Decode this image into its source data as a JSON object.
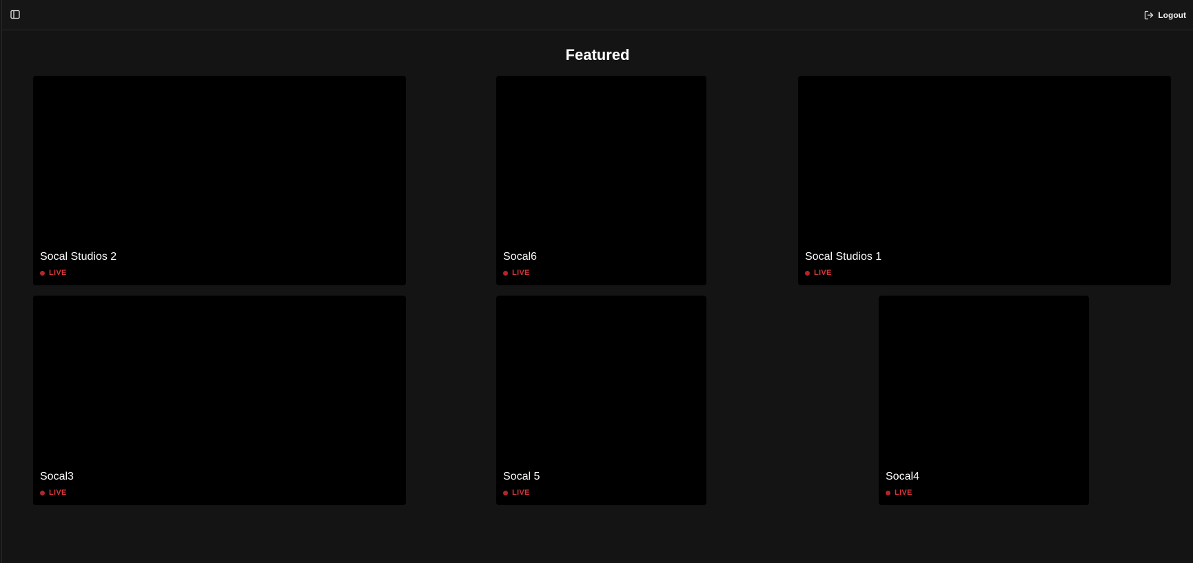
{
  "header": {
    "sidebar_toggle_icon": "sidebar-panel-icon",
    "logout_icon": "logout-icon",
    "logout_label": "Logout"
  },
  "main": {
    "title": "Featured",
    "streams": [
      {
        "name": "Socal Studios 2",
        "status": "LIVE"
      },
      {
        "name": "Socal6",
        "status": "LIVE"
      },
      {
        "name": "Socal Studios 1",
        "status": "LIVE"
      },
      {
        "name": "Socal3",
        "status": "LIVE"
      },
      {
        "name": "Socal 5",
        "status": "LIVE"
      },
      {
        "name": "Socal4",
        "status": "LIVE"
      }
    ]
  },
  "colors": {
    "background": "#141414",
    "card": "#000000",
    "live": "#d6363a"
  }
}
